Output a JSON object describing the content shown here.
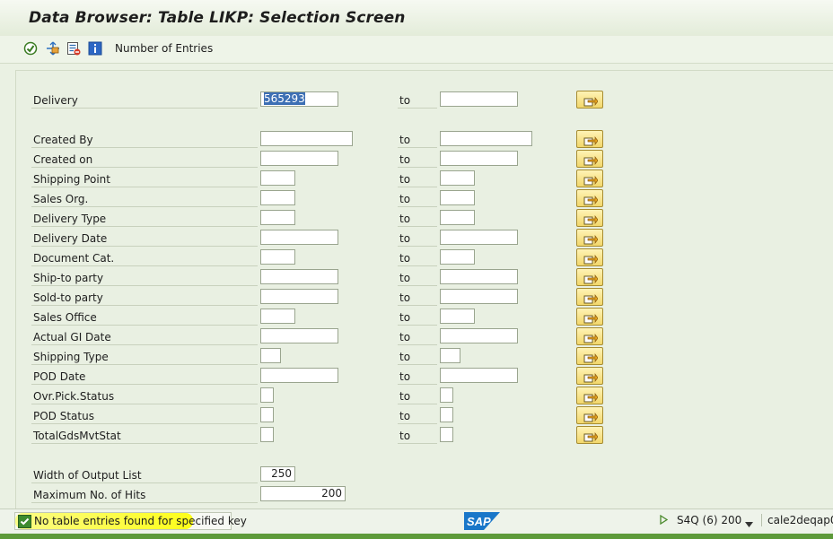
{
  "title": "Data Browser: Table LIKP: Selection Screen",
  "toolbar": {
    "number_of_entries_label": "Number of Entries",
    "icons": [
      "execute-icon",
      "choose-icon",
      "delete-selections-icon",
      "info-icon"
    ]
  },
  "to_label": "to",
  "fields": {
    "delivery": {
      "label": "Delivery",
      "from": "565293",
      "to": ""
    },
    "created_by": {
      "label": "Created By",
      "from": "",
      "to": ""
    },
    "created_on": {
      "label": "Created on",
      "from": "",
      "to": ""
    },
    "shipping_point": {
      "label": "Shipping Point",
      "from": "",
      "to": ""
    },
    "sales_org": {
      "label": "Sales Org.",
      "from": "",
      "to": ""
    },
    "delivery_type": {
      "label": "Delivery Type",
      "from": "",
      "to": ""
    },
    "delivery_date": {
      "label": "Delivery Date",
      "from": "",
      "to": ""
    },
    "document_cat": {
      "label": "Document Cat.",
      "from": "",
      "to": ""
    },
    "ship_to_party": {
      "label": "Ship-to party",
      "from": "",
      "to": ""
    },
    "sold_to_party": {
      "label": "Sold-to party",
      "from": "",
      "to": ""
    },
    "sales_office": {
      "label": "Sales Office",
      "from": "",
      "to": ""
    },
    "actual_gi_date": {
      "label": "Actual GI Date",
      "from": "",
      "to": ""
    },
    "shipping_type": {
      "label": "Shipping Type",
      "from": "",
      "to": ""
    },
    "pod_date": {
      "label": "POD Date",
      "from": "",
      "to": ""
    },
    "ovr_pick_status": {
      "label": "Ovr.Pick.Status",
      "from": "",
      "to": ""
    },
    "pod_status": {
      "label": "POD Status",
      "from": "",
      "to": ""
    },
    "total_gds_mvt_stat": {
      "label": "TotalGdsMvtStat",
      "from": "",
      "to": ""
    }
  },
  "output": {
    "width_label": "Width of Output List",
    "width_value": "250",
    "max_hits_label": "Maximum No. of Hits",
    "max_hits_value": "200"
  },
  "status": {
    "message": "No table entries found for specified key",
    "system": "S4Q (6) 200",
    "host": "cale2deqap01",
    "logo_text": "SAP"
  },
  "colors": {
    "background": "#eaf1e3",
    "multi_select_button": "#f2d76b",
    "highlight": "#ffff00",
    "status_ok": "#3d8b2f",
    "sap_logo": "#1a77c9"
  }
}
